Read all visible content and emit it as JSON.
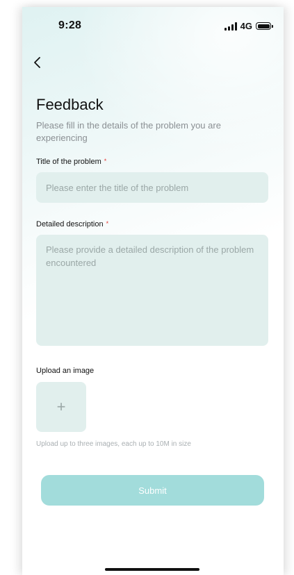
{
  "status_bar": {
    "time": "9:28",
    "network": "4G",
    "icons": [
      "signal-icon",
      "battery-icon"
    ]
  },
  "nav": {
    "back_icon": "chevron-left-icon"
  },
  "header": {
    "title": "Feedback",
    "subtitle": "Please fill in the details of the problem you are experiencing"
  },
  "form": {
    "title_field": {
      "label": "Title of the problem",
      "required_mark": "*",
      "value": "",
      "placeholder": "Please enter the title of the problem"
    },
    "description_field": {
      "label": "Detailed description",
      "required_mark": "*",
      "value": "",
      "placeholder": "Please provide a detailed description of the problem encountered"
    },
    "upload": {
      "label": "Upload an image",
      "button_symbol": "+",
      "icon": "plus-icon",
      "hint": "Upload up to three images, each up to 10M in size"
    },
    "submit_label": "Submit"
  },
  "colors": {
    "accent": "#a2dcdb",
    "field_background": "#e1efed",
    "required": "#e53935"
  }
}
